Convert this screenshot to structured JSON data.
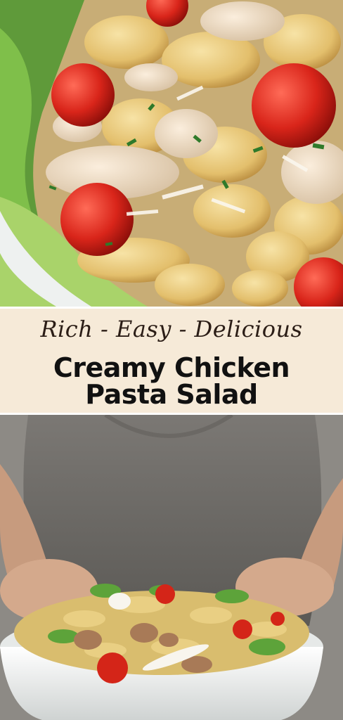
{
  "pin": {
    "tagline": "Rich - Easy - Delicious",
    "title_line_1": "Creamy Chicken",
    "title_line_2": "Pasta Salad"
  },
  "colors": {
    "title_band": "#f6ead8",
    "title_text": "#111111",
    "tagline_text": "#2b1d16"
  }
}
